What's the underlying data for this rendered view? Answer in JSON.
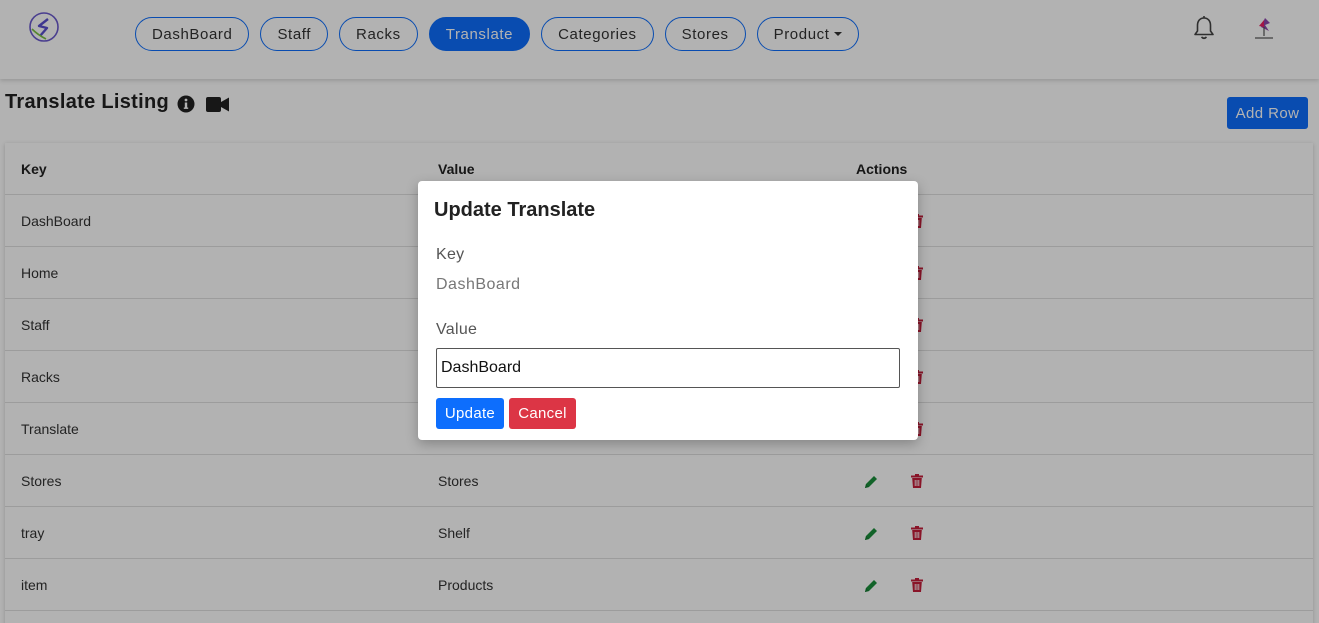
{
  "nav": {
    "items": [
      {
        "label": "DashBoard"
      },
      {
        "label": "Staff"
      },
      {
        "label": "Racks"
      },
      {
        "label": "Translate"
      },
      {
        "label": "Categories"
      },
      {
        "label": "Stores"
      },
      {
        "label": "Product"
      }
    ],
    "active": "Translate",
    "accent_color": "#0d6efd"
  },
  "page": {
    "title": "Translate Listing",
    "add_row_label": "Add Row"
  },
  "table": {
    "headers": {
      "key": "Key",
      "value": "Value",
      "actions": "Actions"
    },
    "rows": [
      {
        "key": "DashBoard",
        "value": ""
      },
      {
        "key": "Home",
        "value": ""
      },
      {
        "key": "Staff",
        "value": ""
      },
      {
        "key": "Racks",
        "value": ""
      },
      {
        "key": "Translate",
        "value": ""
      },
      {
        "key": "Stores",
        "value": "Stores"
      },
      {
        "key": "tray",
        "value": "Shelf"
      },
      {
        "key": "item",
        "value": "Products"
      }
    ]
  },
  "modal": {
    "title": "Update Translate",
    "key_label": "Key",
    "key_value": "DashBoard",
    "value_label": "Value",
    "value_input": "DashBoard",
    "update_label": "Update",
    "cancel_label": "Cancel"
  },
  "icons": {
    "edit": "pencil-icon",
    "delete": "trash-icon",
    "edit_color": "#1a8f3c",
    "delete_color": "#c41e3a"
  }
}
